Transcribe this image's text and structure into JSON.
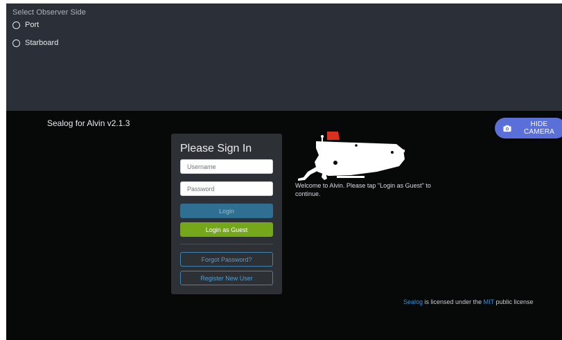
{
  "observer": {
    "title": "Select Observer Side",
    "options": [
      {
        "label": "Port",
        "selected": false
      },
      {
        "label": "Starboard",
        "selected": false
      }
    ]
  },
  "header": {
    "app_title": "Sealog for Alvin v2.1.3",
    "hide_camera_label": "HIDE CAMERA"
  },
  "signin": {
    "title": "Please Sign In",
    "username_placeholder": "Username",
    "password_placeholder": "Password",
    "login_label": "Login",
    "guest_label": "Login as Guest",
    "forgot_label": "Forgot Password?",
    "register_label": "Register New User"
  },
  "welcome": {
    "text": "Welcome to Alvin. Please tap \"Login as Guest\" to continue."
  },
  "footer": {
    "sealog_link": "Sealog",
    "text_mid": " is licensed under the ",
    "mit_link": "MIT",
    "text_end": " public license"
  },
  "colors": {
    "accent_camera": "#5b6fd9",
    "login": "#2f6f92",
    "guest": "#74a81a",
    "link": "#3f8fd0",
    "sub_hull": "#ffffff",
    "sub_sail": "#d8311f"
  },
  "icons": {
    "camera": "camera-icon",
    "radio": "radio-unchecked-icon"
  }
}
